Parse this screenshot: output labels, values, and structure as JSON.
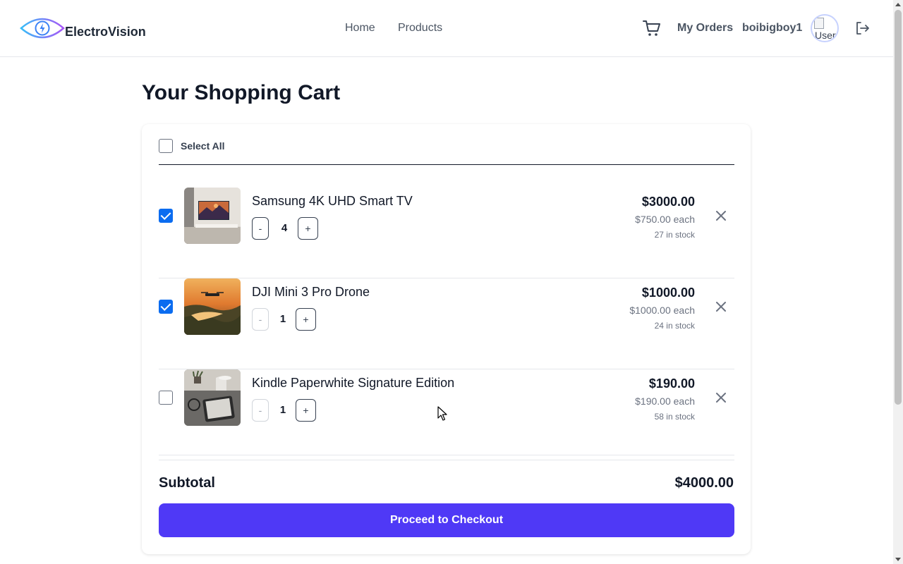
{
  "header": {
    "brand": "ElectroVision",
    "nav": {
      "home": "Home",
      "products": "Products"
    },
    "my_orders": "My Orders",
    "username": "boibigboy1",
    "avatar_alt": "User",
    "icons": {
      "logo": "eye-bolt-logo-icon",
      "cart": "cart-icon",
      "logout": "logout-icon"
    }
  },
  "page": {
    "title": "Your Shopping Cart"
  },
  "cart": {
    "select_all_label": "Select All",
    "select_all_checked": false,
    "items": [
      {
        "name": "Samsung 4K UHD Smart TV",
        "quantity": "4",
        "total": "$3000.00",
        "each": "$750.00 each",
        "stock": "27 in stock",
        "checked": true,
        "decrement": "-",
        "increment": "+"
      },
      {
        "name": "DJI Mini 3 Pro Drone",
        "quantity": "1",
        "total": "$1000.00",
        "each": "$1000.00 each",
        "stock": "24 in stock",
        "checked": true,
        "decrement": "-",
        "increment": "+"
      },
      {
        "name": "Kindle Paperwhite Signature Edition",
        "quantity": "1",
        "total": "$190.00",
        "each": "$190.00 each",
        "stock": "58 in stock",
        "checked": false,
        "decrement": "-",
        "increment": "+"
      }
    ],
    "subtotal_label": "Subtotal",
    "subtotal_value": "$4000.00",
    "checkout_label": "Proceed to Checkout"
  },
  "colors": {
    "accent": "#4f39f6",
    "checkbox": "#0b6cf0",
    "logo_gradient_start": "#38bdf8",
    "logo_gradient_end": "#a855f7"
  }
}
